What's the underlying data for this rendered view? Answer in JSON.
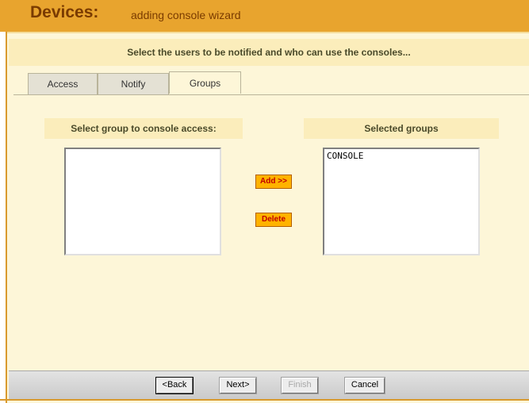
{
  "header": {
    "title": "Devices:",
    "subtitle": "adding console wizard"
  },
  "instruction": "Select the users to be notified and who can use the consoles...",
  "tabs": [
    {
      "label": "Access",
      "active": false
    },
    {
      "label": "Notify",
      "active": false
    },
    {
      "label": "Groups",
      "active": true
    }
  ],
  "left_panel": {
    "heading": "Select group to console access:",
    "items": []
  },
  "right_panel": {
    "heading": "Selected groups",
    "items": [
      "CONSOLE"
    ]
  },
  "actions": {
    "add_label": "Add >>",
    "delete_label": "Delete"
  },
  "footer": {
    "back_label": "<Back",
    "next_label": "Next>",
    "finish_label": "Finish",
    "cancel_label": "Cancel"
  },
  "colors": {
    "header_bg": "#e8a42e",
    "header_text": "#7a3b00",
    "panel_bg": "#fdf6d8",
    "band_bg": "#fbedbb",
    "action_btn_bg": "#ffb300",
    "action_btn_text": "#c00000"
  }
}
